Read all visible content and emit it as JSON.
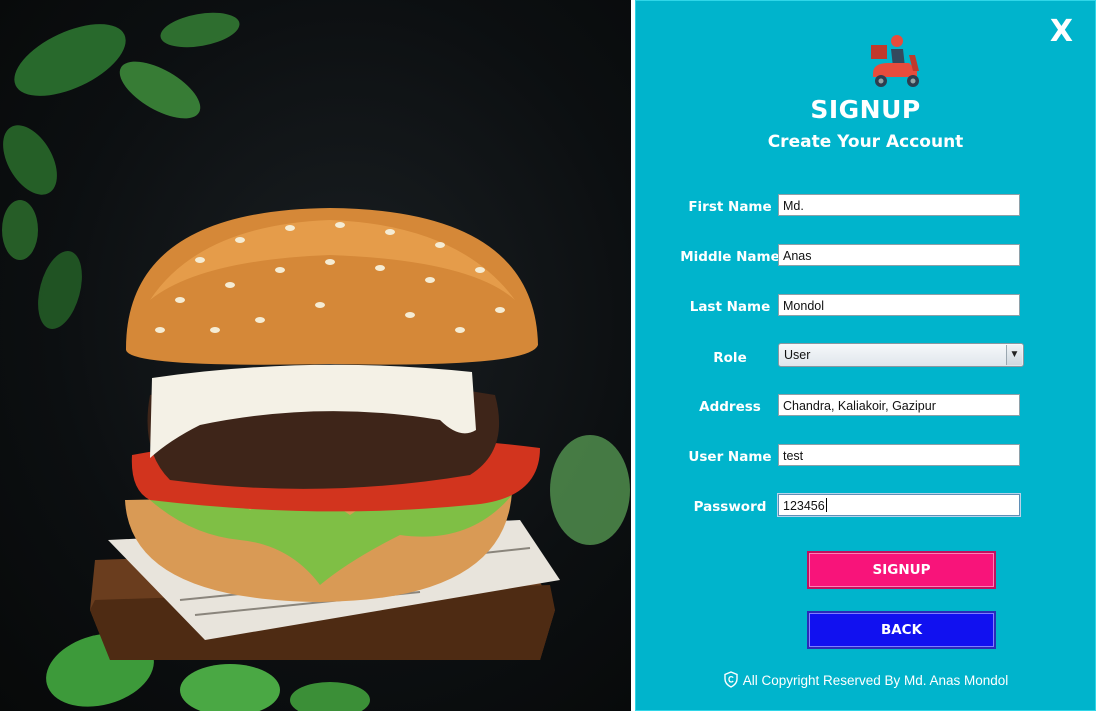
{
  "window": {
    "close_label": "X"
  },
  "signup": {
    "title": "SIGNUP",
    "subtitle": "Create Your Account",
    "fields": {
      "first_name": {
        "label": "First Name",
        "value": "Md."
      },
      "middle_name": {
        "label": "Middle Name",
        "value": "Anas"
      },
      "last_name": {
        "label": "Last Name",
        "value": "Mondol"
      },
      "role": {
        "label": "Role",
        "value": "User"
      },
      "address": {
        "label": "Address",
        "value": "Chandra, Kaliakoir, Gazipur"
      },
      "user_name": {
        "label": "User Name",
        "value": "test"
      },
      "password": {
        "label": "Password",
        "value": "123456"
      }
    },
    "buttons": {
      "signup": "SIGNUP",
      "back": "BACK"
    },
    "footer": "All Copyright Reserved By Md. Anas Mondol"
  },
  "colors": {
    "panel_bg": "#00b4cc",
    "signup_button": "#f8147a",
    "back_button": "#1111f0"
  },
  "icons": {
    "logo": "delivery-scooter-icon",
    "close": "close-icon",
    "footer": "copyright-shield-icon",
    "role_dropdown": "chevron-down-icon"
  }
}
